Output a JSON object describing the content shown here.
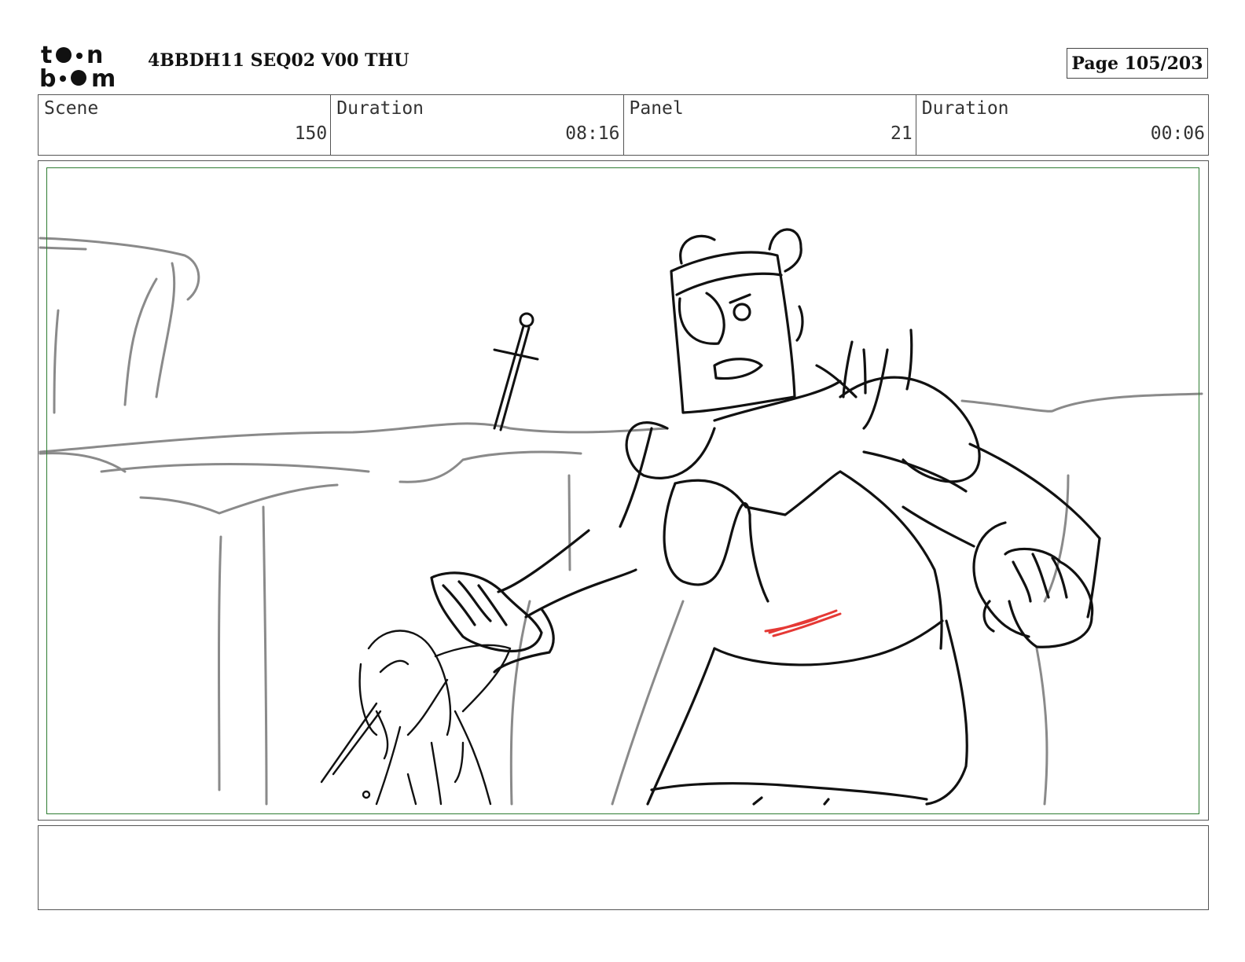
{
  "header": {
    "logo_alt": "toon boom",
    "project_title": "4BBDH11 SEQ02 V00 THU",
    "page_label": "Page 105/203"
  },
  "info": {
    "scene_label": "Scene",
    "scene_value": "150",
    "scene_duration_label": "Duration",
    "scene_duration_value": "08:16",
    "panel_label": "Panel",
    "panel_value": "21",
    "panel_duration_label": "Duration",
    "panel_duration_value": "00:06"
  },
  "notes": {
    "text": ""
  },
  "colors": {
    "safe_frame": "#2e7d32",
    "accent_stroke": "#e53935",
    "background_stroke": "#8a8a8a"
  }
}
